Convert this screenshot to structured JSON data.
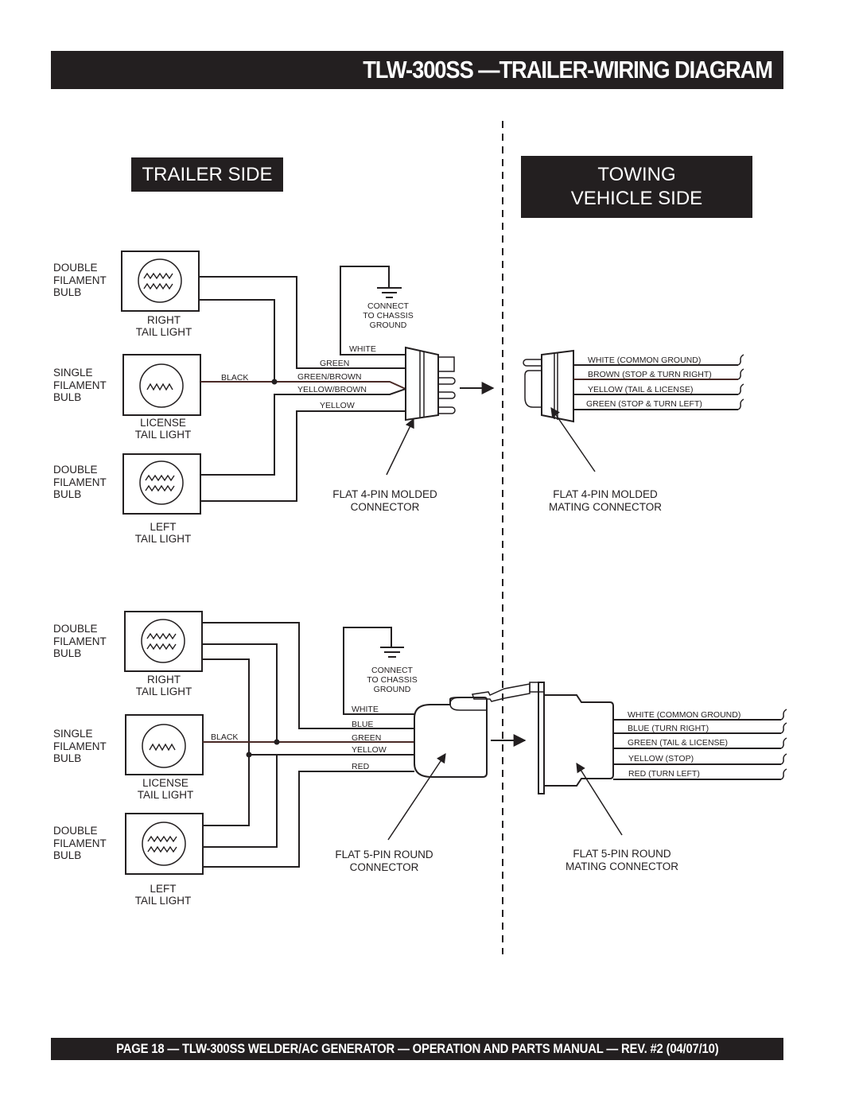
{
  "page_title": "TLW-300SS —TRAILER-WIRING DIAGRAM",
  "footer": "PAGE 18 — TLW-300SS WELDER/AC GENERATOR — OPERATION AND PARTS  MANUAL — REV. #2  (04/07/10)",
  "sides": {
    "trailer": "TRAILER SIDE",
    "towing_line1": "TOWING",
    "towing_line2": "VEHICLE SIDE"
  },
  "bulbs": {
    "double": [
      "DOUBLE",
      "FILAMENT",
      "BULB"
    ],
    "single": [
      "SINGLE",
      "FILAMENT",
      "BULB"
    ]
  },
  "lights": {
    "right": [
      "RIGHT",
      "TAIL LIGHT"
    ],
    "license": [
      "LICENSE",
      "TAIL LIGHT"
    ],
    "left": [
      "LEFT",
      "TAIL LIGHT"
    ]
  },
  "ground_note": [
    "CONNECT",
    "TO CHASSIS",
    "GROUND"
  ],
  "four_pin": {
    "trailer_wires": {
      "black": "BLACK",
      "white": "WHITE",
      "green": "GREEN",
      "green_brown": "GREEN/BROWN",
      "yellow_brown": "YELLOW/BROWN",
      "yellow": "YELLOW"
    },
    "connector_label": [
      "FLAT 4-PIN MOLDED",
      "CONNECTOR"
    ],
    "mating_label": [
      "FLAT 4-PIN MOLDED",
      "MATING CONNECTOR"
    ],
    "vehicle_wires": [
      "WHITE (COMMON GROUND)",
      "BROWN (STOP & TURN RIGHT)",
      "YELLOW (TAIL & LICENSE)",
      "GREEN (STOP & TURN LEFT)"
    ]
  },
  "five_pin": {
    "trailer_wires": {
      "black": "BLACK",
      "white": "WHITE",
      "blue": "BLUE",
      "green": "GREEN",
      "yellow": "YELLOW",
      "red": "RED"
    },
    "connector_label": [
      "FLAT 5-PIN ROUND",
      "CONNECTOR"
    ],
    "mating_label": [
      "FLAT 5-PIN ROUND",
      "MATING CONNECTOR"
    ],
    "vehicle_wires": [
      "WHITE (COMMON GROUND)",
      "BLUE (TURN RIGHT)",
      "GREEN (TAIL & LICENSE)",
      "YELLOW (STOP)",
      "RED (TURN LEFT)"
    ]
  }
}
